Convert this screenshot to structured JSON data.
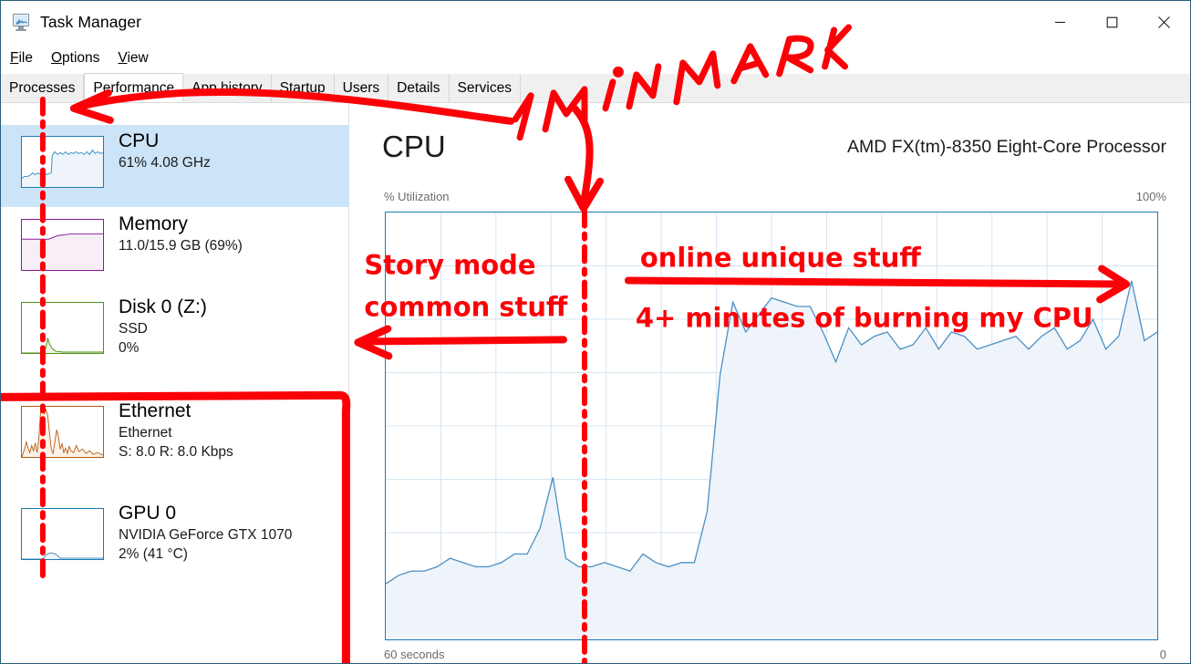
{
  "window": {
    "title": "Task Manager",
    "icon": "task-manager-icon",
    "minimize": "—",
    "maximize": "□",
    "close": "✕"
  },
  "menu": {
    "items": [
      {
        "label": "File",
        "accel": "F"
      },
      {
        "label": "Options",
        "accel": "O"
      },
      {
        "label": "View",
        "accel": "V"
      }
    ]
  },
  "tabs": [
    {
      "label": "Processes",
      "active": false
    },
    {
      "label": "Performance",
      "active": true
    },
    {
      "label": "App history",
      "active": false
    },
    {
      "label": "Startup",
      "active": false
    },
    {
      "label": "Users",
      "active": false
    },
    {
      "label": "Details",
      "active": false
    },
    {
      "label": "Services",
      "active": false
    }
  ],
  "sidebar": {
    "items": [
      {
        "name": "CPU",
        "title": "CPU",
        "sub1": "61%  4.08 GHz",
        "sub2": "",
        "selected": true,
        "accent": "#1a7cb5"
      },
      {
        "name": "Memory",
        "title": "Memory",
        "sub1": "11.0/15.9 GB (69%)",
        "sub2": "",
        "selected": false,
        "accent": "#8a1a9b"
      },
      {
        "name": "Disk 0 (Z:)",
        "title": "Disk 0 (Z:)",
        "sub1": "SSD",
        "sub2": "0%",
        "selected": false,
        "accent": "#4f9117"
      },
      {
        "name": "Ethernet",
        "title": "Ethernet",
        "sub1": "Ethernet",
        "sub2": "S: 8.0  R: 8.0 Kbps",
        "selected": false,
        "accent": "#b8590c"
      },
      {
        "name": "GPU 0",
        "title": "GPU 0",
        "sub1": "NVIDIA GeForce GTX 1070",
        "sub2": "2%  (41 °C)",
        "selected": false,
        "accent": "#1a7cb5"
      }
    ]
  },
  "main": {
    "title": "CPU",
    "cpu_name": "AMD FX(tm)-8350 Eight-Core Processor",
    "y_label": "% Utilization",
    "y_max": "100%",
    "x_left": "60 seconds",
    "x_right": "0"
  },
  "annotations": {
    "color": "#fb0007",
    "texts": [
      {
        "id": "one-min-mark",
        "text": "1 MIN MARK",
        "style": "handwritten"
      },
      {
        "id": "story-mode-line1",
        "text": "Story mode",
        "style": "bold"
      },
      {
        "id": "story-mode-line2",
        "text": "common stuff",
        "style": "bold"
      },
      {
        "id": "online-unique",
        "text": "online unique stuff",
        "style": "bold"
      },
      {
        "id": "burning-cpu",
        "text": "4+ minutes of burning my CPU",
        "style": "bold"
      }
    ],
    "marks": [
      "arrow-to-processes-tab",
      "arrow-down-to-1min-mark",
      "dash-dot-vertical-sidebar",
      "dash-dot-vertical-chart",
      "arrow-left-story-mode",
      "arrow-right-online-unique",
      "red-box-around-ethernet-gpu"
    ]
  },
  "chart_data": {
    "type": "area",
    "title": "CPU",
    "subtitle": "AMD FX(tm)-8350 Eight-Core Processor",
    "xlabel": "60 seconds",
    "ylabel": "% Utilization",
    "ylim": [
      0,
      100
    ],
    "xlim": [
      60,
      0
    ],
    "grid": true,
    "legend": false,
    "line_color": "#4a90c4",
    "fill_color": "#eef4fa",
    "marker_x_seconds": 45,
    "marker_label": "1 MIN MARK",
    "x": [
      60,
      59,
      58,
      57,
      56,
      55,
      54,
      53,
      52,
      51,
      50,
      49,
      48,
      47,
      46,
      45,
      44,
      43,
      42,
      41,
      40,
      39,
      38,
      37,
      36,
      35,
      34,
      33,
      32,
      31,
      30,
      29,
      28,
      27,
      26,
      25,
      24,
      23,
      22,
      21,
      20,
      19,
      18,
      17,
      16,
      15,
      14,
      13,
      12,
      11,
      10,
      9,
      8,
      7,
      6,
      5,
      4,
      3,
      2,
      1,
      0
    ],
    "values": [
      13,
      15,
      16,
      16,
      17,
      19,
      18,
      17,
      17,
      18,
      20,
      20,
      26,
      38,
      19,
      17,
      17,
      18,
      17,
      16,
      20,
      18,
      17,
      18,
      18,
      30,
      62,
      79,
      72,
      76,
      80,
      79,
      78,
      78,
      72,
      65,
      73,
      69,
      71,
      72,
      68,
      69,
      73,
      68,
      72,
      71,
      68,
      69,
      70,
      71,
      68,
      71,
      73,
      68,
      70,
      75,
      68,
      71,
      84,
      70,
      72
    ],
    "notes": [
      {
        "text": "Story mode common stuff",
        "x_range": [
          60,
          45
        ]
      },
      {
        "text": "online unique stuff",
        "x_range": [
          45,
          0
        ]
      },
      {
        "text": "4+ minutes of burning my CPU",
        "x_range": [
          45,
          0
        ]
      }
    ]
  }
}
